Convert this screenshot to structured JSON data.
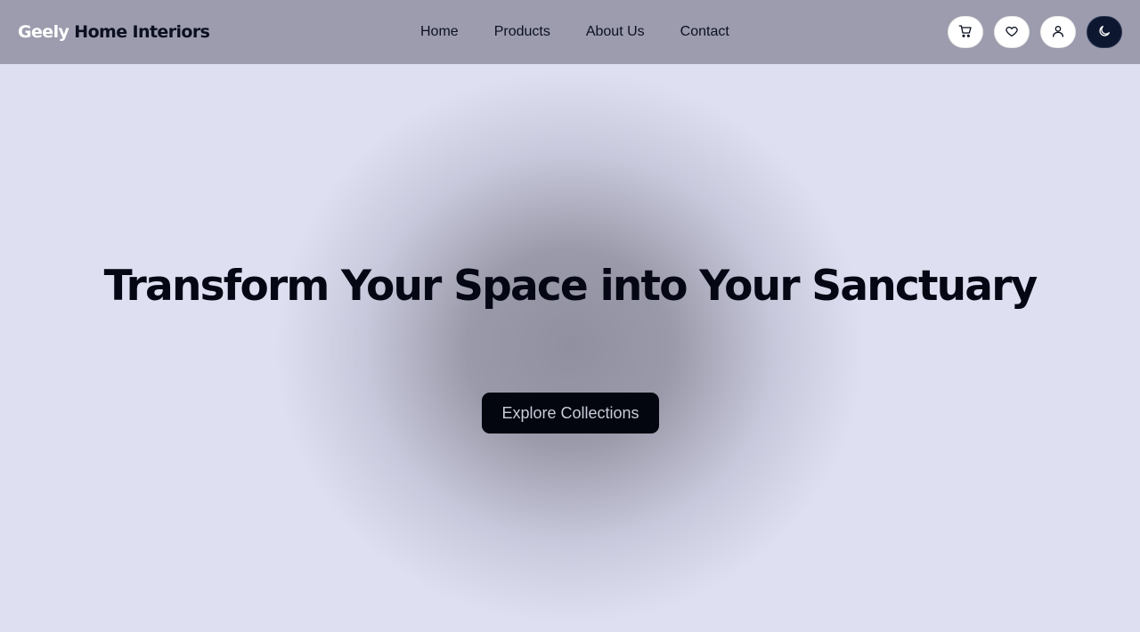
{
  "brand": {
    "part1": "Geely",
    "part2": "Home Interiors"
  },
  "nav": {
    "links": [
      {
        "label": "Home"
      },
      {
        "label": "Products"
      },
      {
        "label": "About Us"
      },
      {
        "label": "Contact"
      }
    ]
  },
  "actions": {
    "icons": [
      "cart-icon",
      "heart-icon",
      "user-icon",
      "moon-icon"
    ]
  },
  "hero": {
    "headline": "Transform Your Space into Your Sanctuary",
    "cta_label": "Explore Collections"
  },
  "colors": {
    "background": "#dedff1",
    "navbar": "#9696a8",
    "text_dark": "#050714",
    "cta_bg": "#03050f",
    "theme_toggle_bg": "#0e1730"
  }
}
